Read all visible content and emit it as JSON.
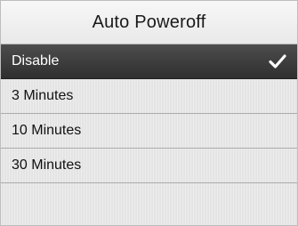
{
  "screen": {
    "title": "Auto Poweroff"
  },
  "menu": {
    "items": [
      {
        "label": "Disable",
        "selected": true,
        "icon": "check-icon"
      },
      {
        "label": "3 Minutes",
        "selected": false
      },
      {
        "label": "10 Minutes",
        "selected": false
      },
      {
        "label": "30 Minutes",
        "selected": false
      }
    ]
  },
  "colors": {
    "selected_background": "#3c3c3c",
    "item_background": "#e4e4e4",
    "title_background": "#efefef"
  }
}
